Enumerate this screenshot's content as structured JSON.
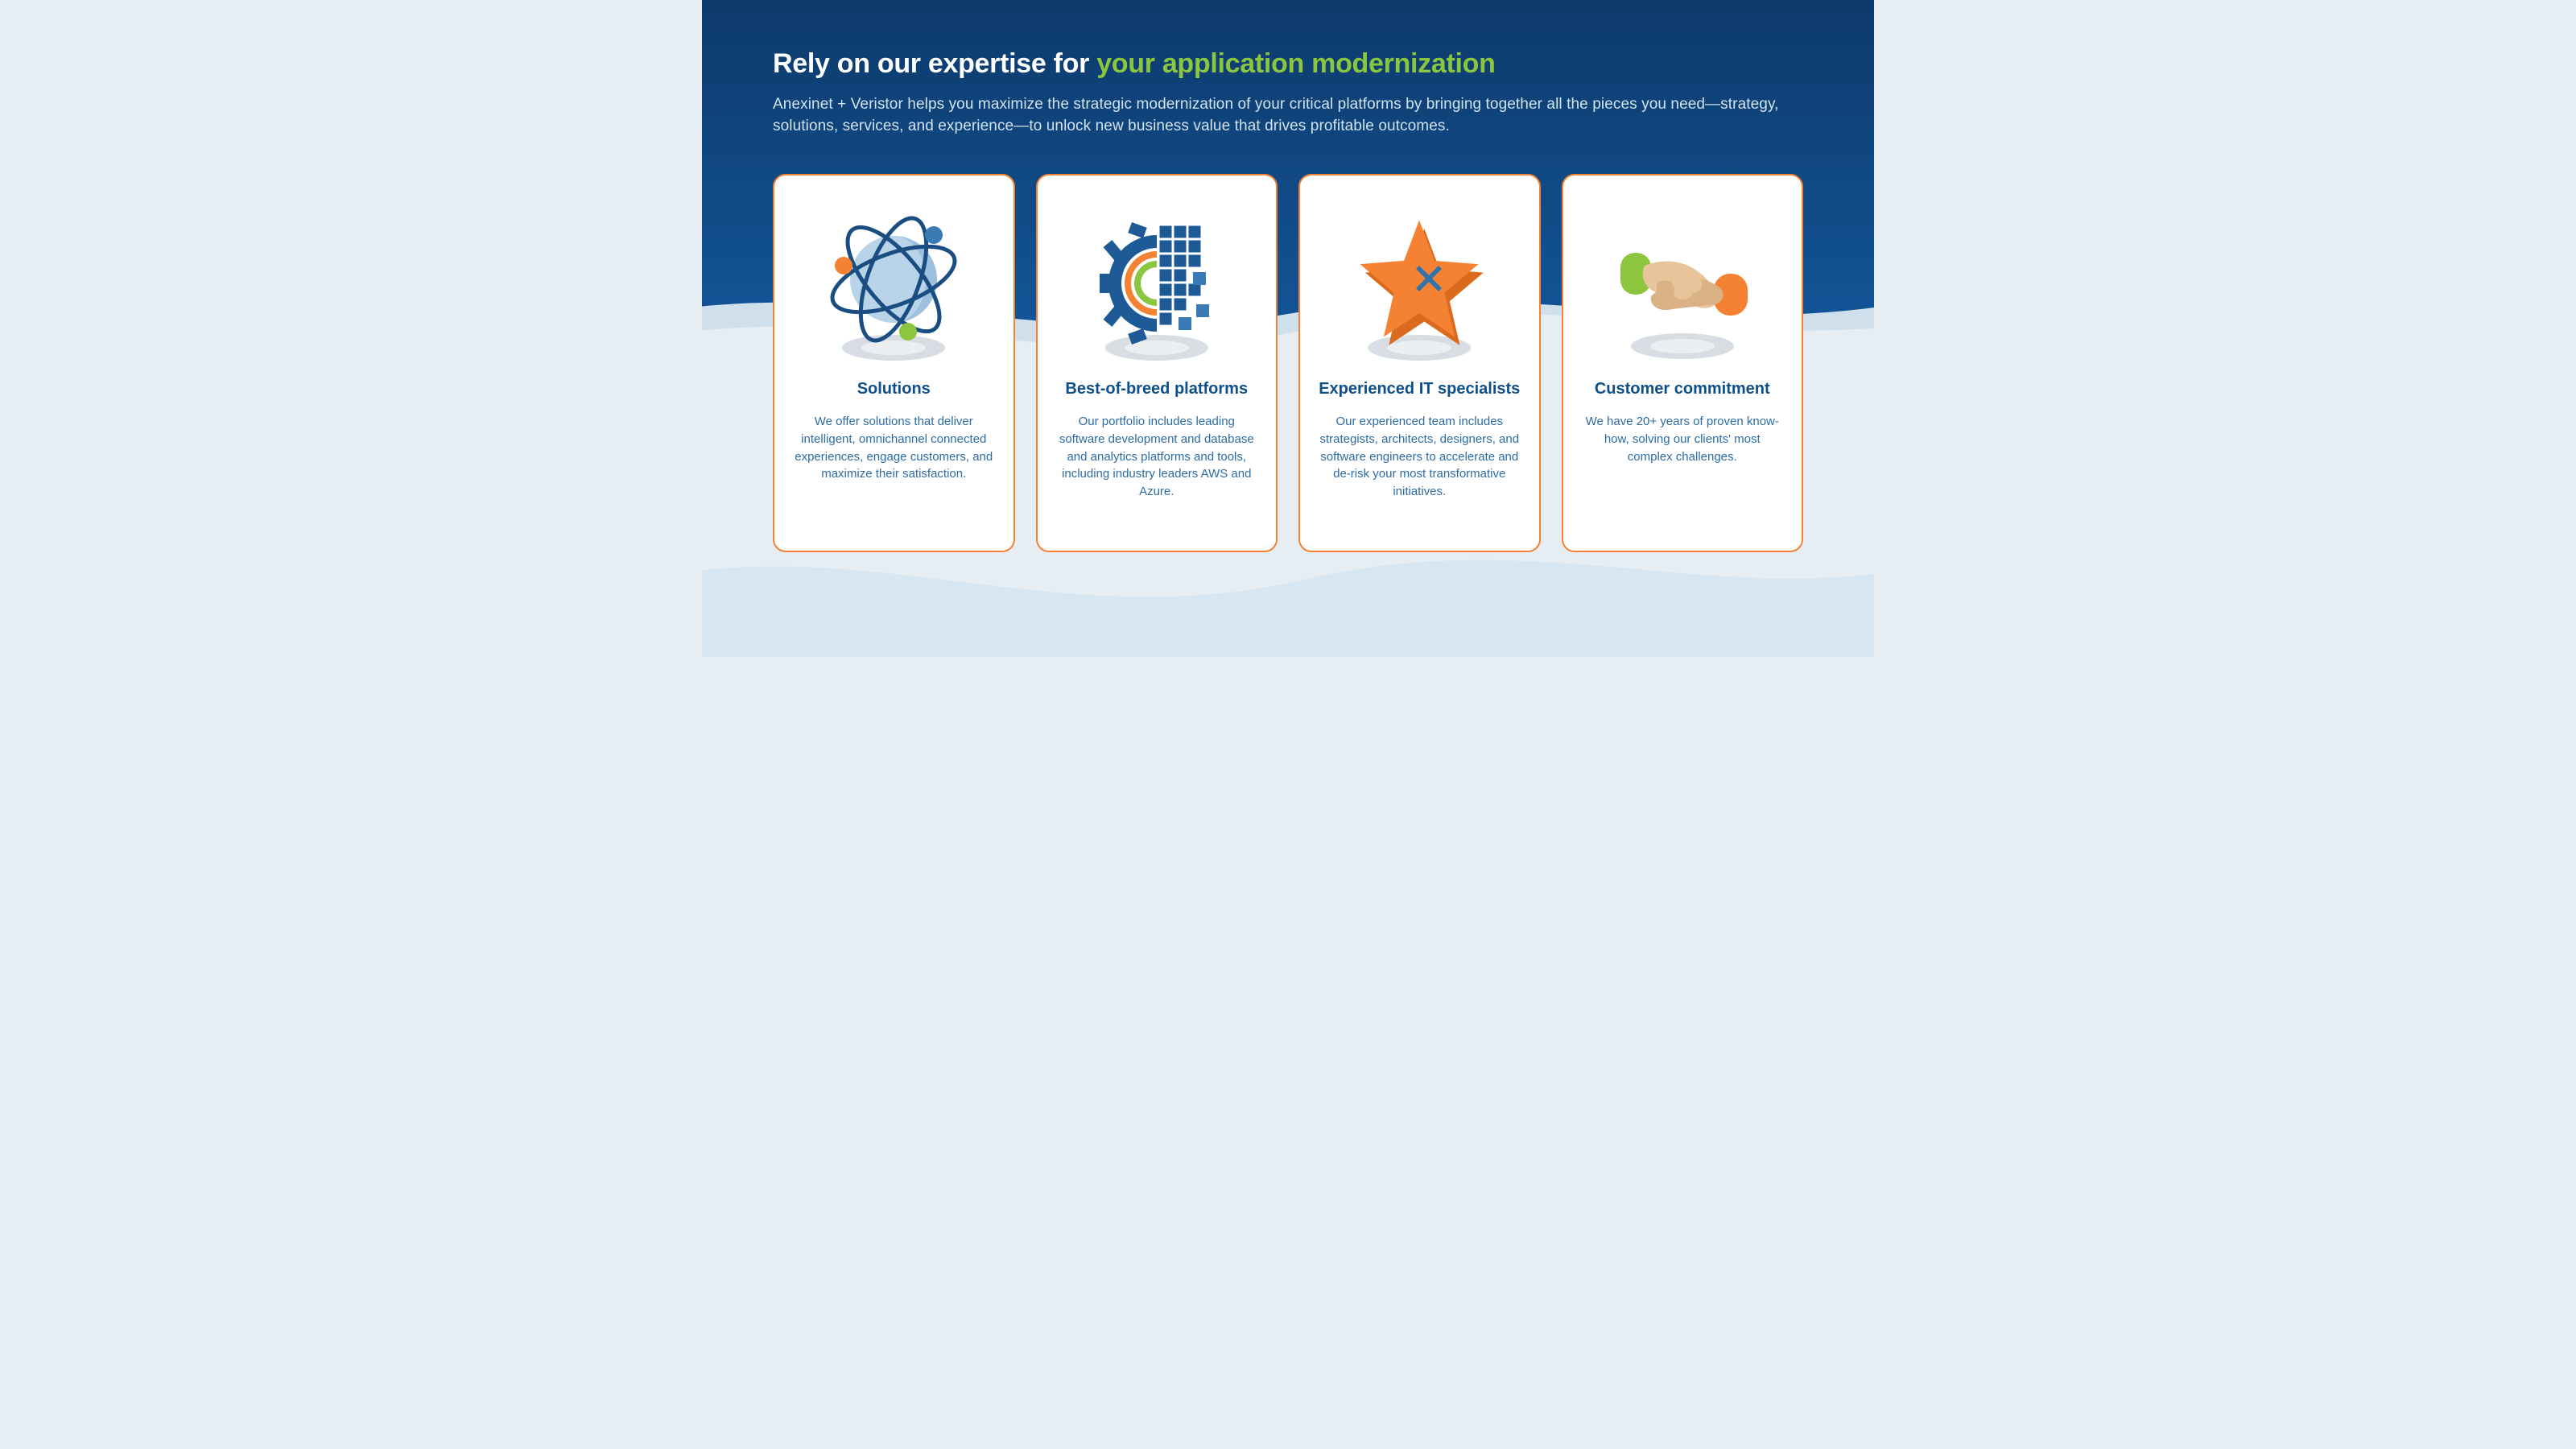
{
  "colors": {
    "accent_green": "#8cc63f",
    "card_border": "#f58233",
    "title_blue": "#0f4f88",
    "body_blue": "#2c6ca3"
  },
  "headline_white": "Rely on our expertise for ",
  "headline_accent": "your application modernization",
  "subhead": "Anexinet + Veristor helps you maximize the strategic modernization of your critical platforms by bringing together all the pieces you need—strategy, solutions, services, and experience—to unlock new business value that drives profitable outcomes.",
  "cards": [
    {
      "title": "Solutions",
      "body": "We offer solutions that deliver intelligent, omnichannel connected experiences, engage customers, and maximize their satisfaction.",
      "icon": "atom"
    },
    {
      "title": "Best-of-breed platforms",
      "body": "Our portfolio includes leading software development and database and analytics platforms and tools, including industry leaders AWS and Azure.",
      "icon": "gear-cubes"
    },
    {
      "title": "Experienced IT specialists",
      "body": "Our experienced team includes strategists, architects, designers, and software engineers to accelerate and de-risk your most transformative initiatives.",
      "icon": "star"
    },
    {
      "title": "Customer commitment",
      "body": "We have 20+ years of proven know-how, solving our clients' most complex challenges.",
      "icon": "handshake"
    }
  ]
}
